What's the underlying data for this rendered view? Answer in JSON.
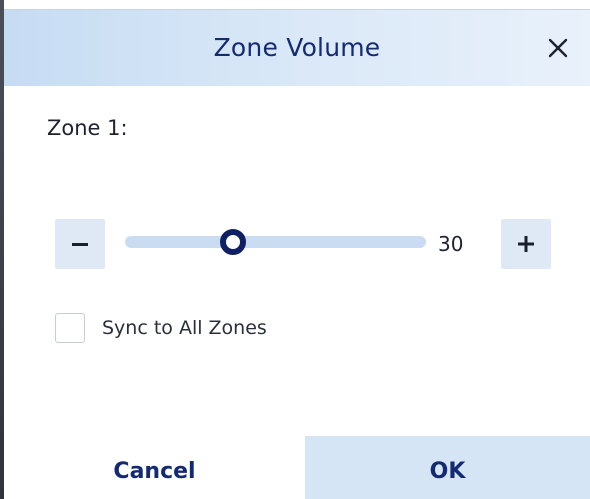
{
  "dialog": {
    "title": "Zone Volume",
    "close_icon": "close-icon"
  },
  "zone": {
    "label": "Zone 1:"
  },
  "volume": {
    "value": "30",
    "level": 0.3,
    "decrease_icon": "minus-icon",
    "increase_icon": "plus-icon"
  },
  "sync": {
    "label": "Sync to All Zones",
    "checked": false
  },
  "footer": {
    "cancel_label": "Cancel",
    "ok_label": "OK"
  },
  "colors": {
    "accent": "#142a73",
    "header_bg": "#d8e7f7",
    "track": "#c9dcf1",
    "thumb": "#0f1f64",
    "ok_bg": "#d6e5f5"
  }
}
